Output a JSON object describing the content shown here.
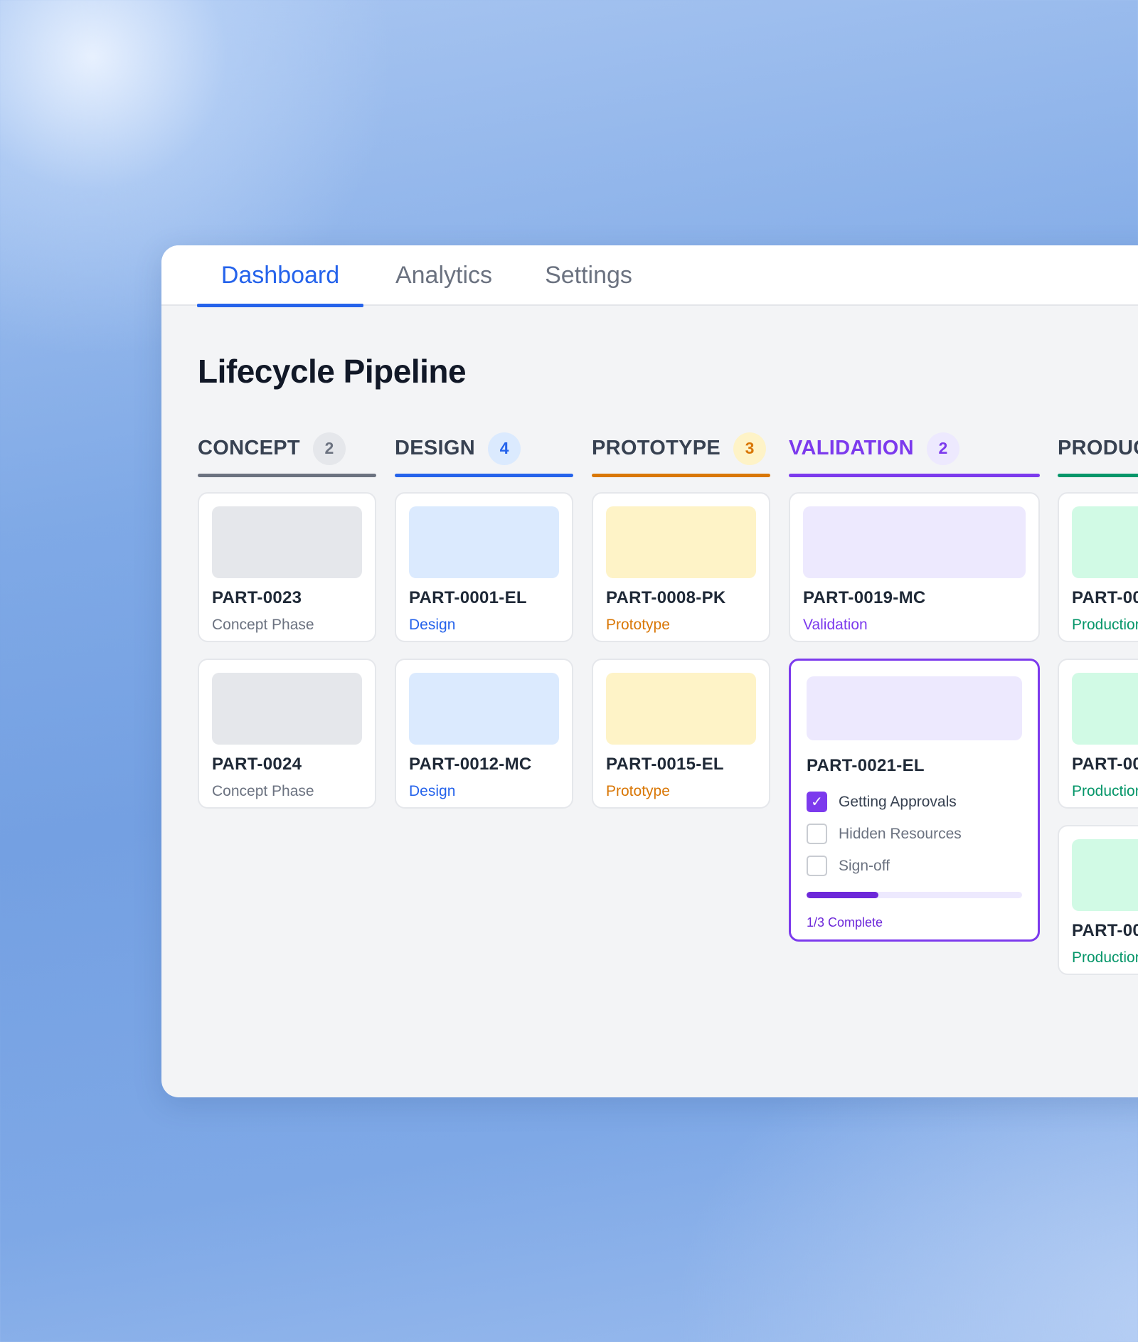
{
  "tabs": [
    {
      "label": "Dashboard",
      "active": true
    },
    {
      "label": "Analytics",
      "active": false
    },
    {
      "label": "Settings",
      "active": false
    }
  ],
  "page_title": "Lifecycle Pipeline",
  "columns": [
    {
      "title": "CONCEPT",
      "count": "2",
      "color": "#6b7280",
      "cards": [
        {
          "id": "PART-0023",
          "phase": "Concept Phase"
        },
        {
          "id": "PART-0024",
          "phase": "Concept Phase"
        }
      ]
    },
    {
      "title": "DESIGN",
      "count": "4",
      "color": "#2563eb",
      "cards": [
        {
          "id": "PART-0001-EL",
          "phase": "Design"
        },
        {
          "id": "PART-0012-MC",
          "phase": "Design"
        }
      ]
    },
    {
      "title": "PROTOTYPE",
      "count": "3",
      "color": "#d97706",
      "cards": [
        {
          "id": "PART-0008-PK",
          "phase": "Prototype"
        },
        {
          "id": "PART-0015-EL",
          "phase": "Prototype"
        }
      ]
    },
    {
      "title": "VALIDATION",
      "count": "2",
      "color": "#7c3aed",
      "cards": [
        {
          "id": "PART-0019-MC",
          "phase": "Validation"
        },
        {
          "id": "PART-0021-EL",
          "checklist": [
            {
              "label": "Getting Approvals",
              "checked": true
            },
            {
              "label": "Hidden Resources",
              "checked": false
            },
            {
              "label": "Sign-off",
              "checked": false
            }
          ],
          "progress": 0.3333,
          "progress_label": "1/3 Complete"
        }
      ]
    },
    {
      "title": "PRODUC",
      "count": "",
      "color": "#059669",
      "cards": [
        {
          "id": "PART-00",
          "phase": "Production"
        },
        {
          "id": "PART-00",
          "phase": "Production"
        },
        {
          "id": "PART-00",
          "phase": "Production"
        }
      ]
    }
  ]
}
